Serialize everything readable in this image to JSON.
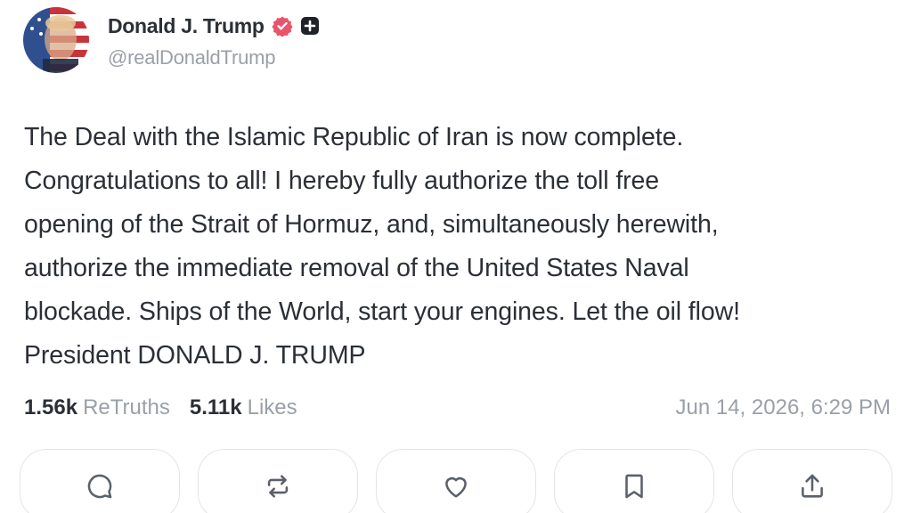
{
  "author": {
    "display_name": "Donald J. Trump",
    "handle": "@realDonaldTrump",
    "avatar_icon": "flag-portrait-avatar",
    "verified_icon": "verified-check-icon",
    "verified_color": "#e9546b",
    "extra_badge_icon": "plus-badge-icon"
  },
  "post": {
    "lines": [
      "The Deal with the Islamic Republic of Iran is now complete.",
      "Congratulations to all! I hereby fully authorize the toll free",
      "opening of the Strait of Hormuz, and, simultaneously herewith,",
      "authorize the immediate removal of the United States Naval",
      "blockade. Ships of the World, start your engines. Let the oil flow!",
      "President DONALD J. TRUMP"
    ]
  },
  "stats": {
    "retruths_count": "1.56k",
    "retruths_label": "ReTruths",
    "likes_count": "5.11k",
    "likes_label": "Likes",
    "timestamp": "Jun 14, 2026, 6:29 PM"
  },
  "actions": [
    {
      "name": "reply",
      "icon": "comment-icon"
    },
    {
      "name": "retruth",
      "icon": "repost-icon"
    },
    {
      "name": "like",
      "icon": "heart-icon"
    },
    {
      "name": "bookmark",
      "icon": "bookmark-icon"
    },
    {
      "name": "share",
      "icon": "share-icon"
    }
  ]
}
